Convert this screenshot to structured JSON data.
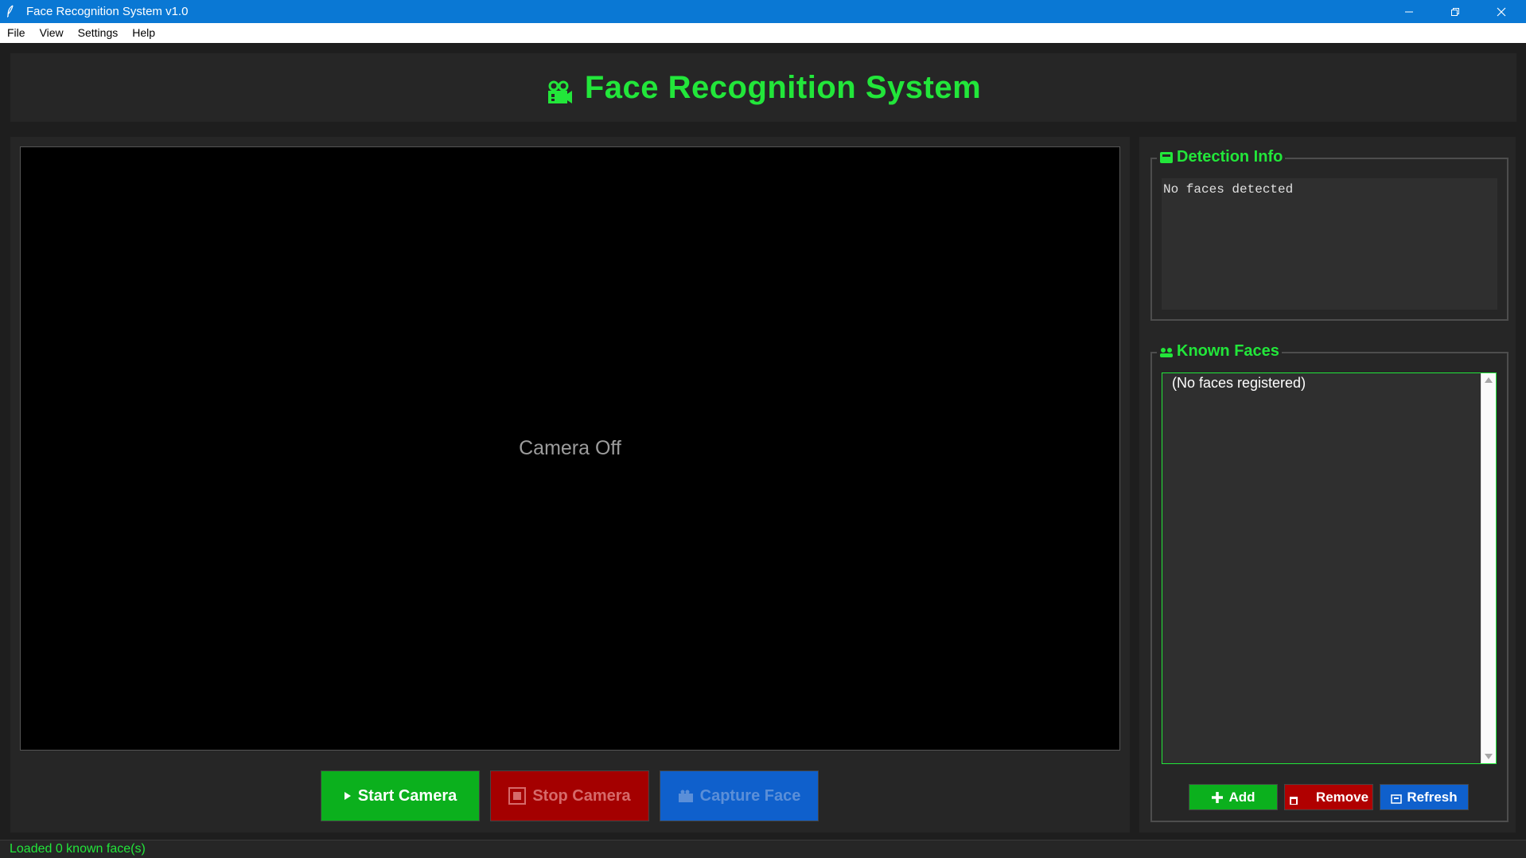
{
  "window": {
    "title": "Face Recognition System v1.0",
    "icon": "feather-icon"
  },
  "menu": [
    "File",
    "View",
    "Settings",
    "Help"
  ],
  "header": {
    "title": "Face Recognition System",
    "icon": "camera-icon"
  },
  "video": {
    "status": "Camera Off"
  },
  "controls": {
    "start_label": "Start Camera",
    "stop_label": "Stop Camera",
    "capture_label": "Capture Face"
  },
  "detection": {
    "title": "Detection Info",
    "text": "No faces detected"
  },
  "known_faces": {
    "title": "Known Faces",
    "items": [
      "(No faces registered)"
    ],
    "add_label": "Add",
    "remove_label": "Remove",
    "refresh_label": "Refresh"
  },
  "status": "Loaded 0 known face(s)",
  "colors": {
    "accent_green": "#22e63a",
    "start_button": "#0bb01d",
    "stop_button": "#a40000",
    "capture_button": "#0f60cc",
    "titlebar": "#0a78d4",
    "panel": "#262626"
  }
}
